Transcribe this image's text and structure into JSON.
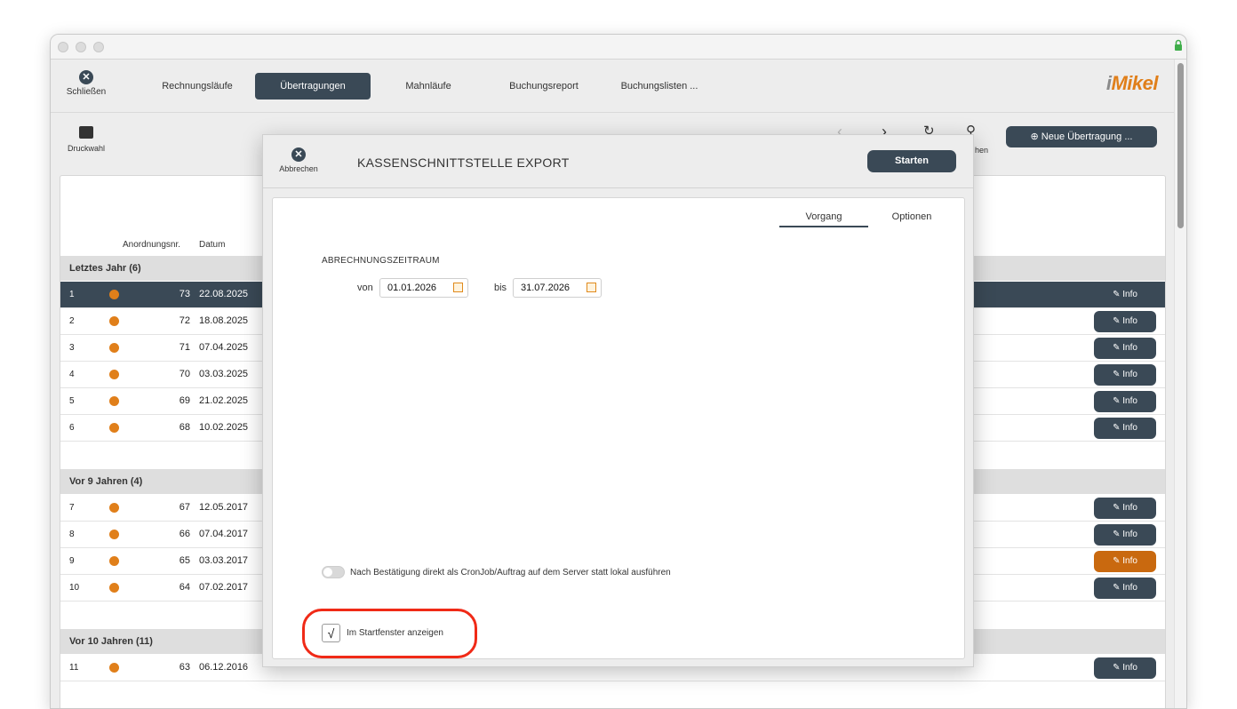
{
  "toolbar": {
    "close_label": "Schließen",
    "tabs": [
      {
        "label": "Rechnungsläufe"
      },
      {
        "label": "Übertragungen"
      },
      {
        "label": "Mahnläufe"
      },
      {
        "label": "Buchungsreport"
      },
      {
        "label": "Buchungslisten ..."
      }
    ],
    "logo_i": "i",
    "logo_text": "Mikel"
  },
  "subtoolbar": {
    "print_label": "Druckwahl",
    "search_label_tail": "hen",
    "new_button": "Neue Übertragung ..."
  },
  "list": {
    "col_nr": "Anordnungsnr.",
    "col_date": "Datum",
    "info_label": "Info",
    "groups": [
      {
        "title": "Letztes Jahr (6)"
      },
      {
        "title": "Vor 9 Jahren (4)"
      },
      {
        "title": "Vor 10 Jahren (11)"
      }
    ],
    "rows": [
      {
        "idx": "1",
        "nr": "73",
        "date": "22.08.2025"
      },
      {
        "idx": "2",
        "nr": "72",
        "date": "18.08.2025"
      },
      {
        "idx": "3",
        "nr": "71",
        "date": "07.04.2025"
      },
      {
        "idx": "4",
        "nr": "70",
        "date": "03.03.2025"
      },
      {
        "idx": "5",
        "nr": "69",
        "date": "21.02.2025"
      },
      {
        "idx": "6",
        "nr": "68",
        "date": "10.02.2025"
      },
      {
        "idx": "7",
        "nr": "67",
        "date": "12.05.2017"
      },
      {
        "idx": "8",
        "nr": "66",
        "date": "07.04.2017"
      },
      {
        "idx": "9",
        "nr": "65",
        "date": "03.03.2017"
      },
      {
        "idx": "10",
        "nr": "64",
        "date": "07.02.2017"
      },
      {
        "idx": "11",
        "nr": "63",
        "date": "06.12.2016"
      }
    ]
  },
  "modal": {
    "cancel_label": "Abbrechen",
    "title": "KASSENSCHNITTSTELLE EXPORT",
    "start_button": "Starten",
    "tabs": [
      {
        "label": "Vorgang"
      },
      {
        "label": "Optionen"
      }
    ],
    "section_label": "ABRECHNUNGSZEITRAUM",
    "from_label": "von",
    "from_value": "01.01.2026",
    "to_label": "bis",
    "to_value": "31.07.2026",
    "toggle_label": "Nach Bestätigung direkt als CronJob/Auftrag auf dem Server statt lokal ausführen",
    "checkbox_mark": "√",
    "checkbox_label": "Im Startfenster anzeigen"
  },
  "colors": {
    "primary": "#3a4956",
    "accent": "#e07f1a",
    "highlight": "#f02a17"
  }
}
